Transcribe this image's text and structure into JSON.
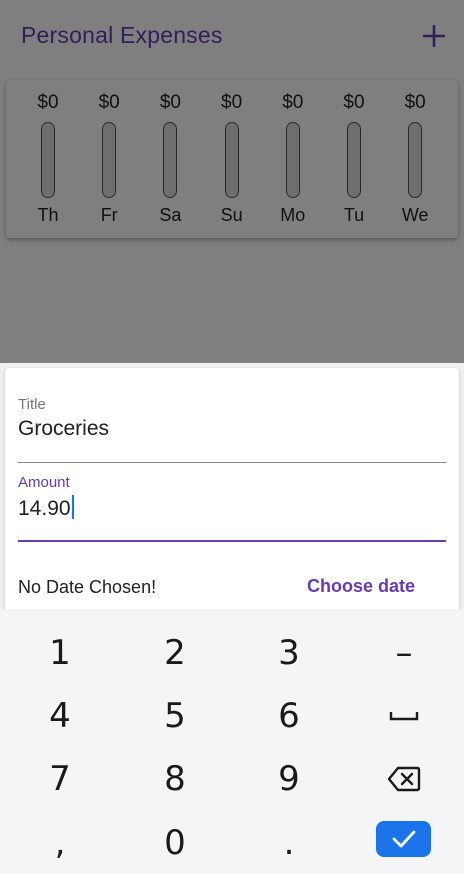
{
  "app": {
    "title": "Personal Expenses",
    "add_icon": "plus-icon",
    "accent_color": "#673ab7"
  },
  "chart": {
    "bars": [
      {
        "day": "Th",
        "amount": "$0",
        "fill_fraction": 0
      },
      {
        "day": "Fr",
        "amount": "$0",
        "fill_fraction": 0
      },
      {
        "day": "Sa",
        "amount": "$0",
        "fill_fraction": 0
      },
      {
        "day": "Su",
        "amount": "$0",
        "fill_fraction": 0
      },
      {
        "day": "Mo",
        "amount": "$0",
        "fill_fraction": 0
      },
      {
        "day": "Tu",
        "amount": "$0",
        "fill_fraction": 0
      },
      {
        "day": "We",
        "amount": "$0",
        "fill_fraction": 0
      }
    ]
  },
  "form": {
    "title_label": "Title",
    "title_value": "Groceries",
    "amount_label": "Amount",
    "amount_value": "14.90",
    "date_text": "No Date Chosen!",
    "choose_date_label": "Choose date"
  },
  "keyboard": {
    "keys": [
      {
        "label": "1",
        "name": "key-1"
      },
      {
        "label": "2",
        "name": "key-2"
      },
      {
        "label": "3",
        "name": "key-3"
      },
      {
        "label": "–",
        "name": "key-minus"
      },
      {
        "label": "4",
        "name": "key-4"
      },
      {
        "label": "5",
        "name": "key-5"
      },
      {
        "label": "6",
        "name": "key-6"
      },
      {
        "label": "",
        "name": "space-key",
        "icon": "space-icon"
      },
      {
        "label": "7",
        "name": "key-7"
      },
      {
        "label": "8",
        "name": "key-8"
      },
      {
        "label": "9",
        "name": "key-9"
      },
      {
        "label": "",
        "name": "backspace-key",
        "icon": "backspace-icon"
      },
      {
        "label": ",",
        "name": "key-comma"
      },
      {
        "label": "0",
        "name": "key-0"
      },
      {
        "label": ".",
        "name": "key-period"
      }
    ],
    "done_icon": "check-icon",
    "done_color": "#1a73e8"
  }
}
